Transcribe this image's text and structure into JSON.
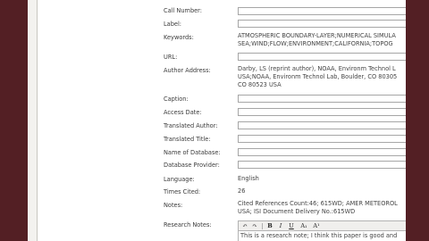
{
  "top_value": "",
  "fields": {
    "call_number": {
      "label": "Call Number:",
      "value": ""
    },
    "label": {
      "label": "Label:",
      "value": ""
    },
    "keywords": {
      "label": "Keywords:",
      "line1": "ATMOSPHERIC BOUNDARY-LAYER;NUMERICAL SIMULA",
      "line2": "SEA;WIND;FLOW;ENVIRONMENT;CALIFORNIA;TOPOG"
    },
    "url": {
      "label": "URL:",
      "value": ""
    },
    "author_address": {
      "label": "Author Address:",
      "line1": "Darby, LS (reprint author), NOAA, Environm Technol L",
      "line2": "USA;NOAA, Environm Technol Lab, Boulder, CO 80305",
      "line3": "CO 80523 USA"
    },
    "caption": {
      "label": "Caption:",
      "value": ""
    },
    "access_date": {
      "label": "Access Date:",
      "value": ""
    },
    "translated_author": {
      "label": "Translated Author:",
      "value": ""
    },
    "translated_title": {
      "label": "Translated Title:",
      "value": ""
    },
    "name_of_database": {
      "label": "Name of Database:",
      "value": ""
    },
    "database_provider": {
      "label": "Database Provider:",
      "value": ""
    },
    "language": {
      "label": "Language:",
      "value": "English"
    },
    "times_cited": {
      "label": "Times Cited:",
      "value": "26"
    },
    "notes": {
      "label": "Notes:",
      "line1": "Cited References Count:46; 615WD; AMER METEOROL",
      "line2": "USA; ISI Document Delivery No.:615WD"
    },
    "research_notes": {
      "label": "Research Notes:",
      "value": "This is a research note; I think this paper is good and"
    }
  },
  "toolbar": {
    "undo": "↶",
    "redo": "↷",
    "bold": "B",
    "italic": "I",
    "underline": "U",
    "subscript": "A₁",
    "superscript": "A¹"
  }
}
